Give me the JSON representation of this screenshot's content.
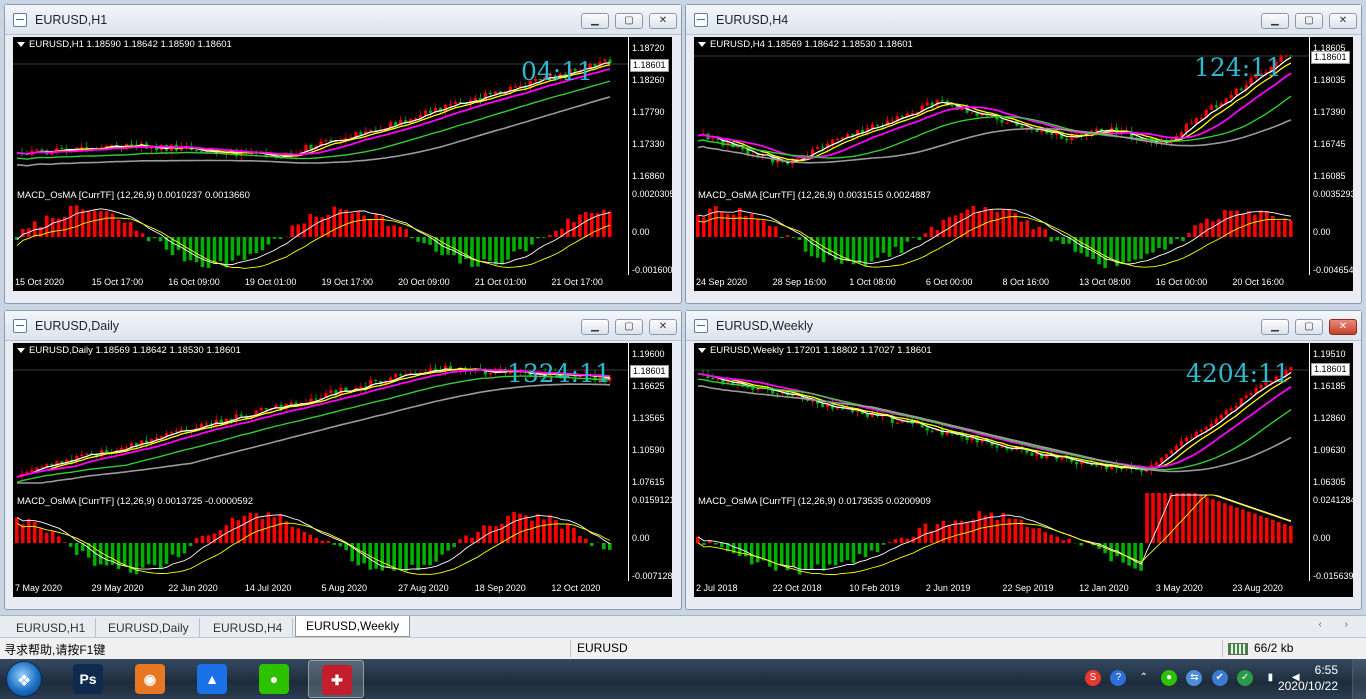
{
  "windows": [
    {
      "id": "h1",
      "title": "EURUSD,H1",
      "info": "EURUSD,H1  1.18590 1.18642 1.18590 1.18601",
      "timer": "04:11",
      "current_price": "1.18601",
      "price_labels": [
        "1.18720",
        "1.18260",
        "1.17790",
        "1.17330",
        "1.16860"
      ],
      "macd_info": "MACD_OsMA [CurrTF] (12,26,9) 0.0010237 0.0013660",
      "macd_labels": [
        "0.0020305",
        "0.00",
        "-0.001600"
      ],
      "dates": [
        "15 Oct 2020",
        "15 Oct 17:00",
        "16 Oct 09:00",
        "19 Oct 01:00",
        "19 Oct 17:00",
        "20 Oct 09:00",
        "21 Oct 01:00",
        "21 Oct 17:00"
      ]
    },
    {
      "id": "h4",
      "title": "EURUSD,H4",
      "info": "EURUSD,H4  1.18569 1.18642 1.18530 1.18601",
      "timer": "124:11",
      "current_price": "1.18601",
      "price_labels": [
        "1.18605",
        "1.18035",
        "1.17390",
        "1.16745",
        "1.16085"
      ],
      "macd_info": "MACD_OsMA [CurrTF] (12,26,9) 0.0031515 0.0024887",
      "macd_labels": [
        "0.0035293",
        "0.00",
        "-0.004654"
      ],
      "dates": [
        "24 Sep 2020",
        "28 Sep 16:00",
        "1 Oct 08:00",
        "6 Oct 00:00",
        "8 Oct 16:00",
        "13 Oct 08:00",
        "16 Oct 00:00",
        "20 Oct 16:00"
      ]
    },
    {
      "id": "d1",
      "title": "EURUSD,Daily",
      "info": "EURUSD,Daily  1.18569 1.18642 1.18530 1.18601",
      "timer": "1324:11",
      "current_price": "1.18601",
      "price_labels": [
        "1.19600",
        "1.16625",
        "1.13565",
        "1.10590",
        "1.07615"
      ],
      "macd_info": "MACD_OsMA [CurrTF] (12,26,9) 0.0013725 -0.0000592",
      "macd_labels": [
        "0.0159121",
        "0.00",
        "-0.007128"
      ],
      "dates": [
        "7 May 2020",
        "29 May 2020",
        "22 Jun 2020",
        "14 Jul 2020",
        "5 Aug 2020",
        "27 Aug 2020",
        "18 Sep 2020",
        "12 Oct 2020"
      ]
    },
    {
      "id": "w1",
      "title": "EURUSD,Weekly",
      "info": "EURUSD,Weekly  1.17201 1.18802 1.17027 1.18601",
      "timer": "4204:11",
      "current_price": "1.18601",
      "price_labels": [
        "1.19510",
        "1.16185",
        "1.12860",
        "1.09630",
        "1.06305"
      ],
      "macd_info": "MACD_OsMA [CurrTF] (12,26,9) 0.0173535 0.0200909",
      "macd_labels": [
        "0.0241284",
        "0.00",
        "-0.015639"
      ],
      "dates": [
        "2 Jul 2018",
        "22 Oct 2018",
        "10 Feb 2019",
        "2 Jun 2019",
        "22 Sep 2019",
        "12 Jan 2020",
        "3 May 2020",
        "23 Aug 2020"
      ]
    }
  ],
  "tabs": [
    "EURUSD,H1",
    "EURUSD,Daily",
    "EURUSD,H4",
    "EURUSD,Weekly"
  ],
  "active_tab": "EURUSD,Weekly",
  "status": {
    "help": "寻求帮助,请按F1键",
    "symbol": "EURUSD",
    "traffic": "66/2 kb"
  },
  "taskbar": {
    "apps": [
      {
        "name": "photoshop",
        "glyph": "Ps",
        "color": "#0f2a4d"
      },
      {
        "name": "thunder",
        "glyph": "◉",
        "color": "#e87722"
      },
      {
        "name": "netdisk",
        "glyph": "▲",
        "color": "#1b72e8"
      },
      {
        "name": "wechat",
        "glyph": "●",
        "color": "#2dc100"
      },
      {
        "name": "metatrader",
        "glyph": "✚",
        "color": "#c21e2c"
      }
    ],
    "time": "6:55",
    "date": "2020/10/22"
  },
  "colors": {
    "bull": "#ff0000",
    "bear": "#00b000",
    "ma_fast": "#ffffff",
    "ma_yellow": "#ffff00",
    "ma_magenta": "#ff00ff",
    "ma_green": "#33cc33",
    "ma_gray": "#9a9a9a",
    "timer": "#2fb7cd"
  }
}
